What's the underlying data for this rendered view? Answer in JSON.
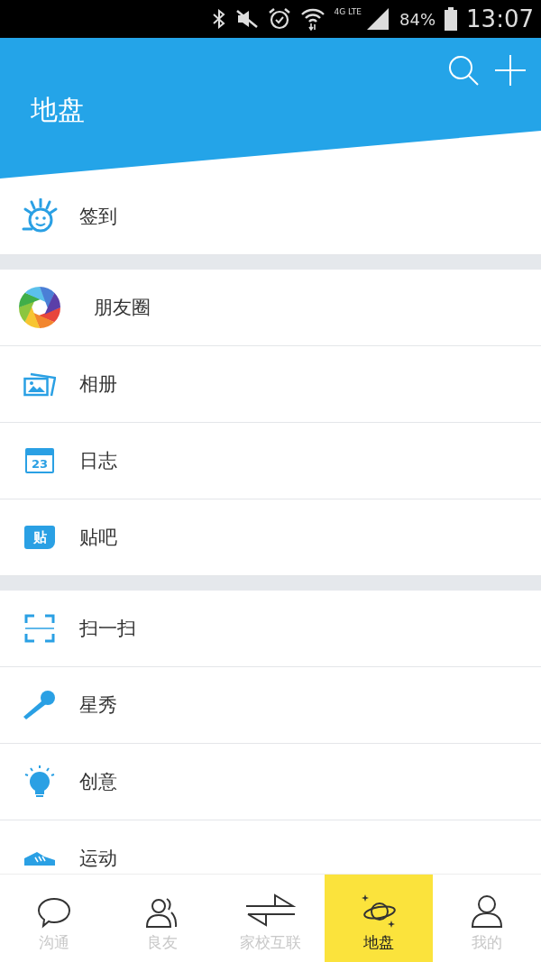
{
  "status_bar": {
    "network": "4G LTE",
    "battery": "84%",
    "time": "13:07"
  },
  "header": {
    "title": "地盘"
  },
  "sections": [
    {
      "items": [
        {
          "kind": "checkin",
          "label": "签到"
        }
      ]
    },
    {
      "items": [
        {
          "kind": "moments",
          "label": "朋友圈"
        },
        {
          "kind": "album",
          "label": "相册"
        },
        {
          "kind": "diary",
          "label": "日志",
          "icon_text": "23"
        },
        {
          "kind": "tieba",
          "label": "贴吧",
          "icon_text": "贴"
        }
      ]
    },
    {
      "items": [
        {
          "kind": "scan",
          "label": "扫一扫"
        },
        {
          "kind": "mic",
          "label": "星秀"
        },
        {
          "kind": "idea",
          "label": "创意"
        },
        {
          "kind": "sport",
          "label": "运动"
        }
      ]
    }
  ],
  "tabs": [
    {
      "kind": "chat",
      "label": "沟通",
      "selected": false
    },
    {
      "kind": "friends",
      "label": "良友",
      "selected": false
    },
    {
      "kind": "exchange",
      "label": "家校互联",
      "selected": false
    },
    {
      "kind": "planet",
      "label": "地盘",
      "selected": true
    },
    {
      "kind": "person",
      "label": "我的",
      "selected": false
    }
  ]
}
